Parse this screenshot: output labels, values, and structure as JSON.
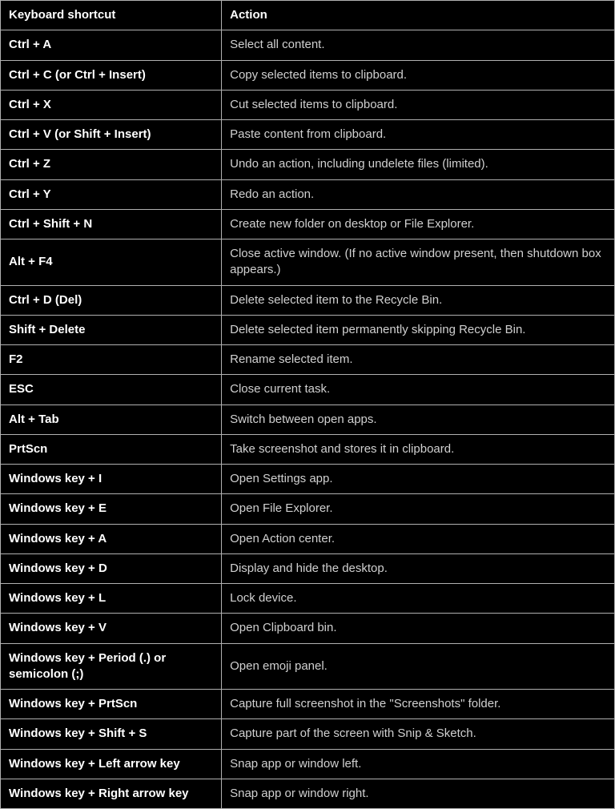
{
  "table": {
    "headers": {
      "shortcut": "Keyboard shortcut",
      "action": "Action"
    },
    "rows": [
      {
        "shortcut": "Ctrl + A",
        "action": "Select all content."
      },
      {
        "shortcut": "Ctrl + C (or Ctrl + Insert)",
        "action": "Copy selected items to clipboard."
      },
      {
        "shortcut": "Ctrl + X",
        "action": "Cut selected items to clipboard."
      },
      {
        "shortcut": "Ctrl + V (or Shift + Insert)",
        "action": "Paste content from clipboard."
      },
      {
        "shortcut": "Ctrl + Z",
        "action": "Undo an action, including undelete files (limited)."
      },
      {
        "shortcut": "Ctrl + Y",
        "action": "Redo an action."
      },
      {
        "shortcut": "Ctrl + Shift + N",
        "action": "Create new folder on desktop or File Explorer."
      },
      {
        "shortcut": "Alt + F4",
        "action": "Close active window. (If no active window present, then shutdown box appears.)"
      },
      {
        "shortcut": "Ctrl + D (Del)",
        "action": "Delete selected item to the Recycle Bin."
      },
      {
        "shortcut": "Shift + Delete",
        "action": "Delete selected item permanently skipping Recycle Bin."
      },
      {
        "shortcut": "F2",
        "action": "Rename selected item."
      },
      {
        "shortcut": "ESC",
        "action": "Close current task."
      },
      {
        "shortcut": "Alt + Tab",
        "action": "Switch between open apps."
      },
      {
        "shortcut": "PrtScn",
        "action": "Take screenshot and stores it in clipboard."
      },
      {
        "shortcut": "Windows key + I",
        "action": "Open Settings app."
      },
      {
        "shortcut": "Windows key + E",
        "action": "Open File Explorer."
      },
      {
        "shortcut": "Windows key + A",
        "action": "Open Action center."
      },
      {
        "shortcut": "Windows key + D",
        "action": "Display and hide the desktop."
      },
      {
        "shortcut": "Windows key + L",
        "action": "Lock device."
      },
      {
        "shortcut": "Windows key + V",
        "action": "Open Clipboard bin."
      },
      {
        "shortcut": "Windows key + Period (.) or semicolon (;)",
        "action": "Open emoji panel."
      },
      {
        "shortcut": "Windows key + PrtScn",
        "action": "Capture full screenshot in the \"Screenshots\" folder."
      },
      {
        "shortcut": "Windows key + Shift + S",
        "action": "Capture part of the screen with Snip & Sketch."
      },
      {
        "shortcut": "Windows key + Left arrow key",
        "action": "Snap app or window left."
      },
      {
        "shortcut": "Windows key + Right arrow key",
        "action": "Snap app or window right."
      }
    ]
  }
}
